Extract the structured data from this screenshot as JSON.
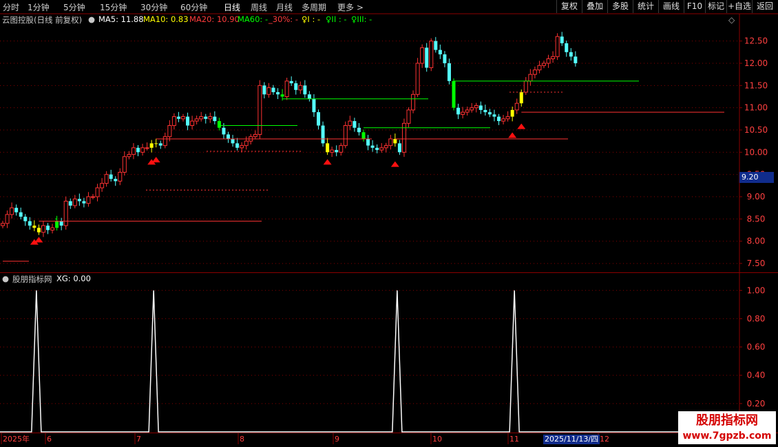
{
  "toolbar": {
    "timeframes": [
      "分时",
      "1分钟",
      "5分钟",
      "15分钟",
      "30分钟",
      "60分钟",
      "日线",
      "周线",
      "月线",
      "多周期",
      "更多 >"
    ],
    "right_buttons": [
      "复权",
      "叠加",
      "多股",
      "统计",
      "画线",
      "F10",
      "标记",
      "+自选",
      "返回"
    ]
  },
  "main_chart": {
    "title": "云图控股(日线 前复权)",
    "ma5": "MA5: 11.88",
    "ma10": "MA10: 0.83",
    "ma20": "MA20: 10.90",
    "ma60": "MA60: -",
    "pct30": "_30%: -",
    "line1": "♀I : -",
    "line2": "♀II : -",
    "line3": "♀III: -",
    "y_ticks": [
      "12.50",
      "12.00",
      "11.50",
      "11.00",
      "10.50",
      "10.00",
      "9.50",
      "9.00",
      "8.50",
      "8.00",
      "7.50"
    ],
    "current_price": "9.20"
  },
  "indicator": {
    "title": "股朋指标网",
    "value": "XG: 0.00",
    "y_ticks": [
      "1.00",
      "0.80",
      "0.60",
      "0.40",
      "0.20"
    ]
  },
  "x_axis": {
    "labels": [
      "2025年",
      "6",
      "7",
      "8",
      "9",
      "10",
      "11",
      "12"
    ],
    "cursor_date": "2025/11/13/四"
  },
  "brand": {
    "line1": "股朋指标网",
    "line2": "www.7gpzb.com"
  },
  "colors": {
    "up": "#ff3232",
    "down": "#54fcfc",
    "signal_yellow": "#ffff00",
    "signal_green": "#00ff00",
    "grid": "#8b0000",
    "signal_line": "#ffffff"
  },
  "chart_data": [
    {
      "type": "candlestick",
      "title": "云图控股(日线 前复权)",
      "x_labels": [
        "2025年",
        "6",
        "7",
        "8",
        "9",
        "10",
        "11",
        "12"
      ],
      "ylim": [
        7.3,
        12.85
      ],
      "y_ticks": [
        7.5,
        8.0,
        8.5,
        9.0,
        9.5,
        10.0,
        10.5,
        11.0,
        11.5,
        12.0,
        12.5
      ],
      "close": [
        8.4,
        8.6,
        8.75,
        8.65,
        8.55,
        8.45,
        8.35,
        8.3,
        8.2,
        8.35,
        8.25,
        8.3,
        8.45,
        8.35,
        8.9,
        8.8,
        8.95,
        8.9,
        8.85,
        9.0,
        9.0,
        9.2,
        9.3,
        9.5,
        9.4,
        9.35,
        9.55,
        9.9,
        9.95,
        10.1,
        10.0,
        10.1,
        10.1,
        10.2,
        10.2,
        10.15,
        10.35,
        10.6,
        10.8,
        10.75,
        10.8,
        10.6,
        10.7,
        10.75,
        10.8,
        10.75,
        10.8,
        10.7,
        10.55,
        10.4,
        10.3,
        10.2,
        10.1,
        10.15,
        10.25,
        10.35,
        10.4,
        11.5,
        11.3,
        11.45,
        11.35,
        11.3,
        11.25,
        11.6,
        11.55,
        11.4,
        11.5,
        11.3,
        11.2,
        10.9,
        10.6,
        10.2,
        10.0,
        10.05,
        10.0,
        10.15,
        10.6,
        10.7,
        10.55,
        10.45,
        10.3,
        10.15,
        10.1,
        10.05,
        10.1,
        10.15,
        10.3,
        10.2,
        10.0,
        10.65,
        10.95,
        11.3,
        12.0,
        12.35,
        11.9,
        12.5,
        12.3,
        12.2,
        12.0,
        11.6,
        11.0,
        10.85,
        10.9,
        10.95,
        11.0,
        11.05,
        10.95,
        10.9,
        10.85,
        10.8,
        10.7,
        10.75,
        10.8,
        10.95,
        11.1,
        11.35,
        11.6,
        11.75,
        11.85,
        11.95,
        12.0,
        12.1,
        12.15,
        12.6,
        12.45,
        12.25,
        12.15,
        12.0
      ],
      "signals_x_index": [
        7,
        8,
        33,
        34,
        72,
        87,
        113,
        115
      ],
      "lows_at_signal": [
        8.2,
        8.25,
        10.0,
        10.05,
        10.0,
        9.95,
        10.6,
        10.8
      ]
    },
    {
      "type": "line",
      "title": "股朋指标网",
      "series": [
        {
          "name": "XG",
          "spike_positions": [
            7,
            33,
            87,
            113
          ],
          "value_at_spike": 1.0
        }
      ],
      "ylim": [
        0,
        1.05
      ],
      "y_ticks": [
        0.2,
        0.4,
        0.6,
        0.8,
        1.0
      ]
    }
  ]
}
